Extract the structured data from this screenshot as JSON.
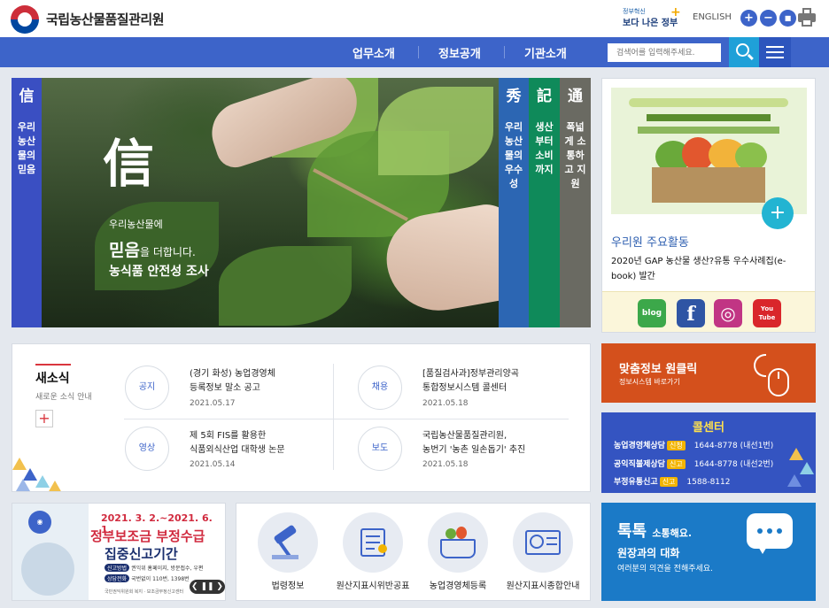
{
  "header": {
    "site_title": "국립농산물품질관리원",
    "gov_badge_small": "정부혁신",
    "gov_badge_main": "보다 나은 정부",
    "english_link": "ENGLISH",
    "zoom_in": "+",
    "zoom_reset": "−",
    "zoom_out": "■"
  },
  "nav": {
    "items": [
      "업무소개",
      "정보공개",
      "기관소개"
    ],
    "search_placeholder": "검색어를 입력해주세요."
  },
  "hero": {
    "panels": [
      {
        "glyph": "信",
        "text": "우리 농산물의 믿음",
        "color": "#3a4fc2"
      },
      {
        "glyph": "秀",
        "text": "우리 농산물의 우수성",
        "color": "#2c66b3"
      },
      {
        "glyph": "記",
        "text": "생산부터 소비까지",
        "color": "#0f8a5a"
      },
      {
        "glyph": "通",
        "text": "폭넓게 소통하고 지원",
        "color": "#6a6a62"
      }
    ],
    "big_glyph": "信",
    "subtitle": "우리농산물에",
    "main_strong": "믿음",
    "main_rest": "을 더합니다.",
    "tagline": "농식품 안전성 조사"
  },
  "activity": {
    "title": "우리원 주요활동",
    "description": "2020년 GAP 농산물 생산?유통 우수사례집(e-book) 발간",
    "social": [
      {
        "name": "blog",
        "label": "blog",
        "color": "#3ca84a"
      },
      {
        "name": "facebook",
        "label": "f",
        "color": "#2f55a4"
      },
      {
        "name": "instagram",
        "label": "◎",
        "color": "#c13584"
      },
      {
        "name": "youtube",
        "label": "You Tube",
        "color": "#d9262b"
      }
    ]
  },
  "news": {
    "title": "새소식",
    "subtitle": "새로운 소식 안내",
    "items": [
      {
        "category": "공지",
        "headline": [
          "(경기 화성) 농업경영체",
          "등록정보 말소 공고"
        ],
        "date": "2021.05.17"
      },
      {
        "category": "채용",
        "headline": [
          "[품질검사과]정부관리양곡",
          "통합정보시스템 콜센터"
        ],
        "date": "2021.05.18"
      },
      {
        "category": "영상",
        "headline": [
          "제 5회 FIS를 활용한",
          "식품외식산업 대학생 논문"
        ],
        "date": "2021.05.14"
      },
      {
        "category": "보도",
        "headline": [
          "국립농산물품질관리원,",
          "농번기 '농촌 일손돕기' 추진"
        ],
        "date": "2021.05.18"
      }
    ]
  },
  "click_info": {
    "title": "맞춤정보 원클릭",
    "subtitle": "정보시스템 바로가기"
  },
  "call_center": {
    "title": "콜센터",
    "rows": [
      {
        "label": "농업경영체상담",
        "tag": "신청",
        "number": "1644-8778 (내선1번)"
      },
      {
        "label": "공익직불제상담",
        "tag": "신고",
        "number": "1644-8778 (내선2번)"
      },
      {
        "label": "부정유통신고",
        "tag": "신고",
        "number": "1588-8112"
      }
    ]
  },
  "banner": {
    "date": "2021. 3. 2.~2021. 6. 1.",
    "line1": "정부보조금 부정수급",
    "line2": "집중신고기간",
    "detail1_pill": "신고방법",
    "detail1": "권익위 홈페이지, 방문접수, 우편",
    "detail2_pill": "상담전화",
    "detail2": "국번없이 110번, 1398번",
    "foot": "국민권익위원회 복지 · 보조금부정신고센터",
    "controls": "❮ ❚❚ ❯"
  },
  "quick_links": [
    {
      "label": "법령정보",
      "icon": "gavel-icon"
    },
    {
      "label": "원산지표시위반공표",
      "icon": "document-icon"
    },
    {
      "label": "농업경영체등록",
      "icon": "basket-icon"
    },
    {
      "label": "원산지표시종합안내",
      "icon": "globe-id-icon"
    }
  ],
  "talk": {
    "title_big": "톡톡",
    "title_small": "소통해요.",
    "heading": "원장과의 대화",
    "sub": "여러분의 의견을 전해주세요."
  }
}
